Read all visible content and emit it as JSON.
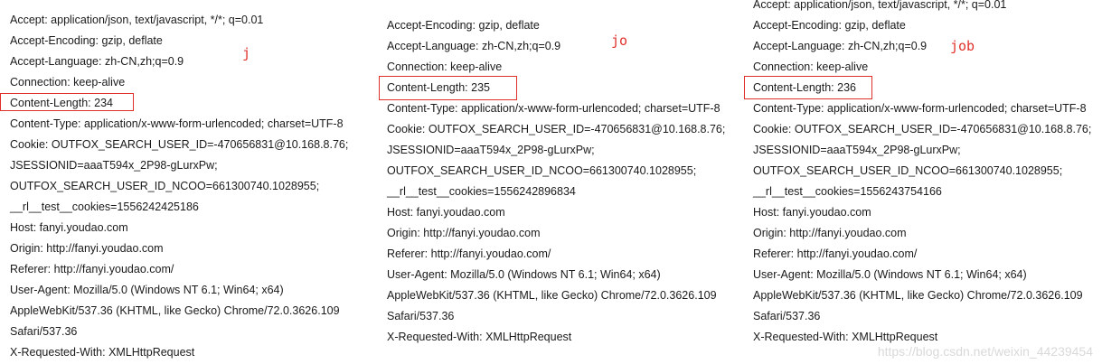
{
  "panels": [
    {
      "annotation": "j",
      "lines": [
        "Accept: application/json, text/javascript, */*; q=0.01",
        "Accept-Encoding: gzip, deflate",
        "Accept-Language: zh-CN,zh;q=0.9",
        "Connection: keep-alive",
        "Content-Length: 234",
        "Content-Type: application/x-www-form-urlencoded; charset=UTF-8",
        "Cookie: OUTFOX_SEARCH_USER_ID=-470656831@10.168.8.76;",
        "JSESSIONID=aaaT594x_2P98-gLurxPw;",
        "OUTFOX_SEARCH_USER_ID_NCOO=661300740.1028955;",
        "__rl__test__cookies=1556242425186",
        "Host: fanyi.youdao.com",
        "Origin: http://fanyi.youdao.com",
        "Referer: http://fanyi.youdao.com/",
        "User-Agent: Mozilla/5.0 (Windows NT 6.1; Win64; x64)",
        "AppleWebKit/537.36 (KHTML, like Gecko) Chrome/72.0.3626.109",
        "Safari/537.36",
        "X-Requested-With: XMLHttpRequest"
      ]
    },
    {
      "annotation": "jo",
      "lines": [
        "Accept-Encoding: gzip, deflate",
        "Accept-Language: zh-CN,zh;q=0.9",
        "Connection: keep-alive",
        "Content-Length: 235",
        "Content-Type: application/x-www-form-urlencoded; charset=UTF-8",
        "Cookie: OUTFOX_SEARCH_USER_ID=-470656831@10.168.8.76;",
        "JSESSIONID=aaaT594x_2P98-gLurxPw;",
        "OUTFOX_SEARCH_USER_ID_NCOO=661300740.1028955;",
        "__rl__test__cookies=1556242896834",
        "Host: fanyi.youdao.com",
        "Origin: http://fanyi.youdao.com",
        "Referer: http://fanyi.youdao.com/",
        "User-Agent: Mozilla/5.0 (Windows NT 6.1; Win64; x64)",
        "AppleWebKit/537.36 (KHTML, like Gecko) Chrome/72.0.3626.109",
        "Safari/537.36",
        "X-Requested-With: XMLHttpRequest"
      ]
    },
    {
      "annotation": "job",
      "lines": [
        "Accept: application/json, text/javascript, */*; q=0.01",
        "Accept-Encoding: gzip, deflate",
        "Accept-Language: zh-CN,zh;q=0.9",
        "Connection: keep-alive",
        "Content-Length: 236",
        "Content-Type: application/x-www-form-urlencoded; charset=UTF-8",
        "Cookie: OUTFOX_SEARCH_USER_ID=-470656831@10.168.8.76;",
        "JSESSIONID=aaaT594x_2P98-gLurxPw;",
        "OUTFOX_SEARCH_USER_ID_NCOO=661300740.1028955;",
        "__rl__test__cookies=1556243754166",
        "Host: fanyi.youdao.com",
        "Origin: http://fanyi.youdao.com",
        "Referer: http://fanyi.youdao.com/",
        "User-Agent: Mozilla/5.0 (Windows NT 6.1; Win64; x64)",
        "AppleWebKit/537.36 (KHTML, like Gecko) Chrome/72.0.3626.109",
        "Safari/537.36",
        "X-Requested-With: XMLHttpRequest"
      ]
    }
  ],
  "watermark": "https://blog.csdn.net/weixin_44239454",
  "colors": {
    "highlight": "#e0302a",
    "annotation": "#e0302a",
    "text": "#1a1a1a",
    "watermark": "#d9d9d9"
  }
}
